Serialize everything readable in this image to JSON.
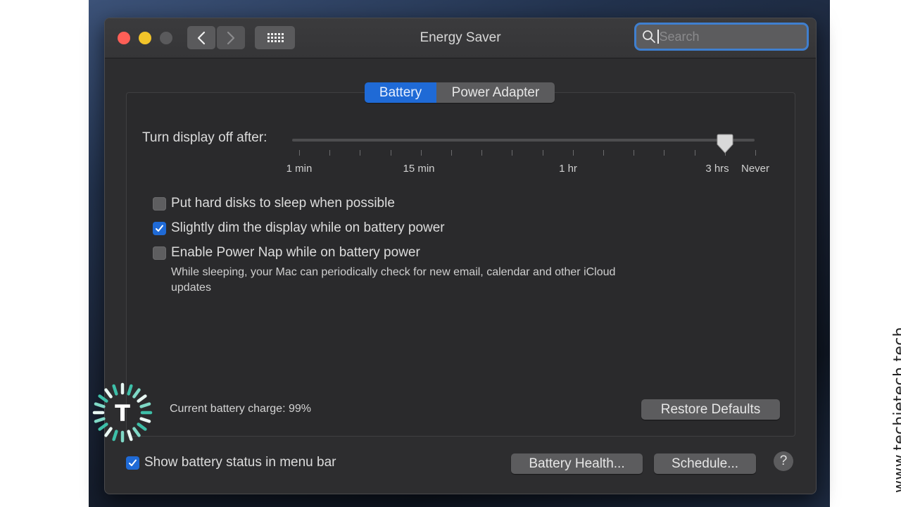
{
  "window": {
    "title": "Energy Saver",
    "search": {
      "placeholder": "Search",
      "value": ""
    }
  },
  "tabs": [
    {
      "label": "Battery",
      "active": true
    },
    {
      "label": "Power Adapter",
      "active": false
    }
  ],
  "slider": {
    "label": "Turn display off after:",
    "tick_labels": [
      "1 min",
      "15 min",
      "1 hr",
      "3 hrs",
      "Never"
    ],
    "tick_count": 16,
    "value": "3 hrs"
  },
  "options": [
    {
      "label": "Put hard disks to sleep when possible",
      "checked": false
    },
    {
      "label": "Slightly dim the display while on battery power",
      "checked": true
    },
    {
      "label": "Enable Power Nap while on battery power",
      "checked": false
    }
  ],
  "power_nap_description": "While sleeping, your Mac can periodically check for new email, calendar and other iCloud updates",
  "battery_charge": "Current battery charge: 99%",
  "buttons": {
    "restore_defaults": "Restore Defaults",
    "battery_health": "Battery Health...",
    "schedule": "Schedule...",
    "help": "?"
  },
  "show_status": {
    "label": "Show battery status in menu bar",
    "checked": true
  },
  "watermark": {
    "text": "www.techietech.tech",
    "logo_letter": "T"
  },
  "colors": {
    "accent": "#1f6ad6",
    "close": "#fe5f57",
    "minimize": "#f2c42a",
    "logo_teal": "#3dbfa8"
  }
}
